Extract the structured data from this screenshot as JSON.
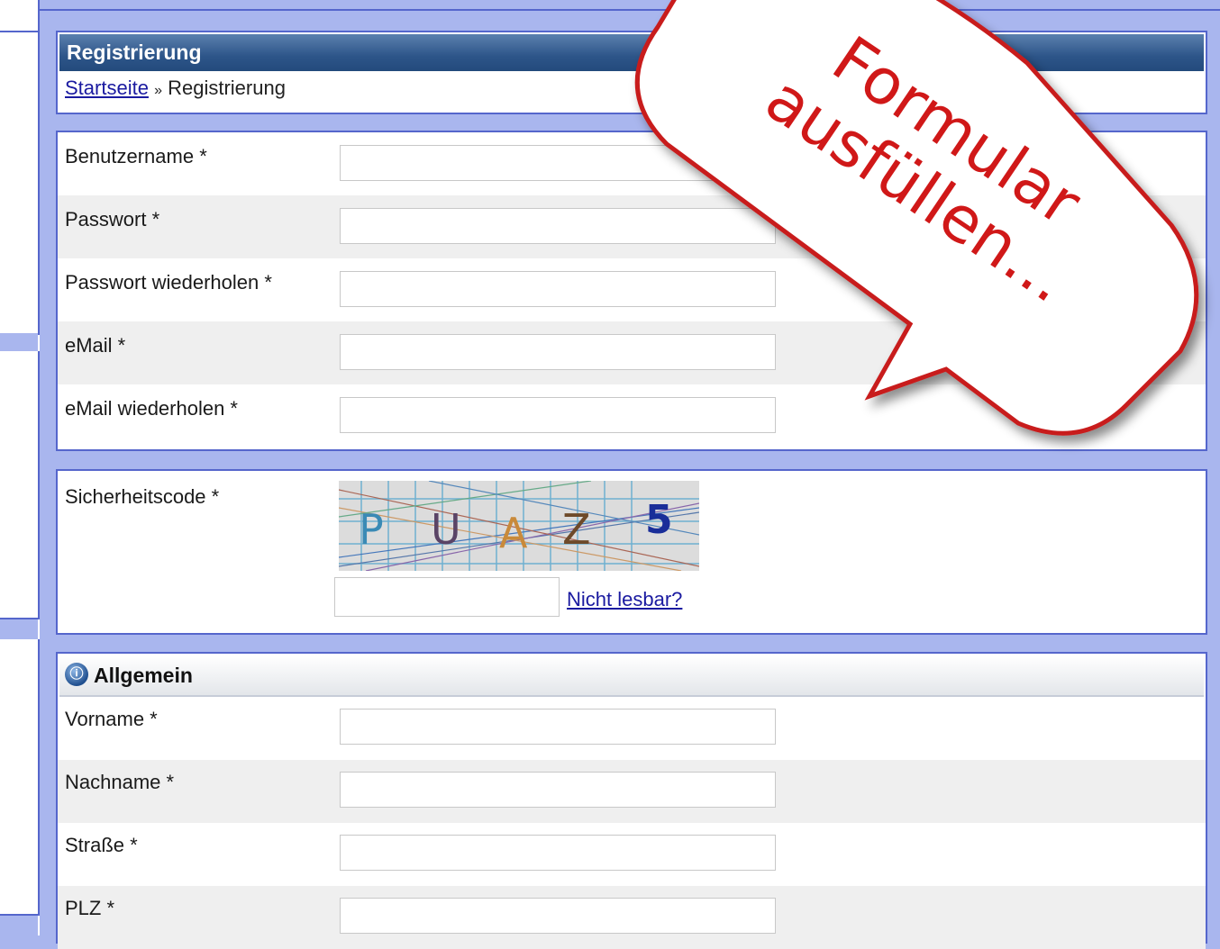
{
  "header": {
    "title": "Registrierung",
    "breadcrumb_home": "Startseite",
    "breadcrumb_sep": "»",
    "breadcrumb_current": "Registrierung"
  },
  "account_fields": [
    {
      "label": "Benutzername *",
      "value": ""
    },
    {
      "label": "Passwort *",
      "value": ""
    },
    {
      "label": "Passwort wiederholen *",
      "value": ""
    },
    {
      "label": "eMail *",
      "value": ""
    },
    {
      "label": "eMail wiederholen *",
      "value": ""
    }
  ],
  "captcha": {
    "label": "Sicherheitscode *",
    "image_text": "PUAZ5",
    "value": "",
    "link": "Nicht lesbar?"
  },
  "general": {
    "title": "Allgemein",
    "icon": "info-icon",
    "fields": [
      {
        "label": "Vorname *",
        "value": ""
      },
      {
        "label": "Nachname *",
        "value": ""
      },
      {
        "label": "Straße *",
        "value": ""
      },
      {
        "label": "PLZ *",
        "value": ""
      }
    ]
  },
  "callout": {
    "line1": "Formular",
    "line2": "ausfüllen..."
  },
  "colors": {
    "page_bg": "#a9b6ee",
    "border": "#5566cc",
    "header_bg": "#2d5589",
    "callout_text": "#d01818",
    "callout_border": "#c81d1d",
    "link": "#1a1aa0"
  }
}
